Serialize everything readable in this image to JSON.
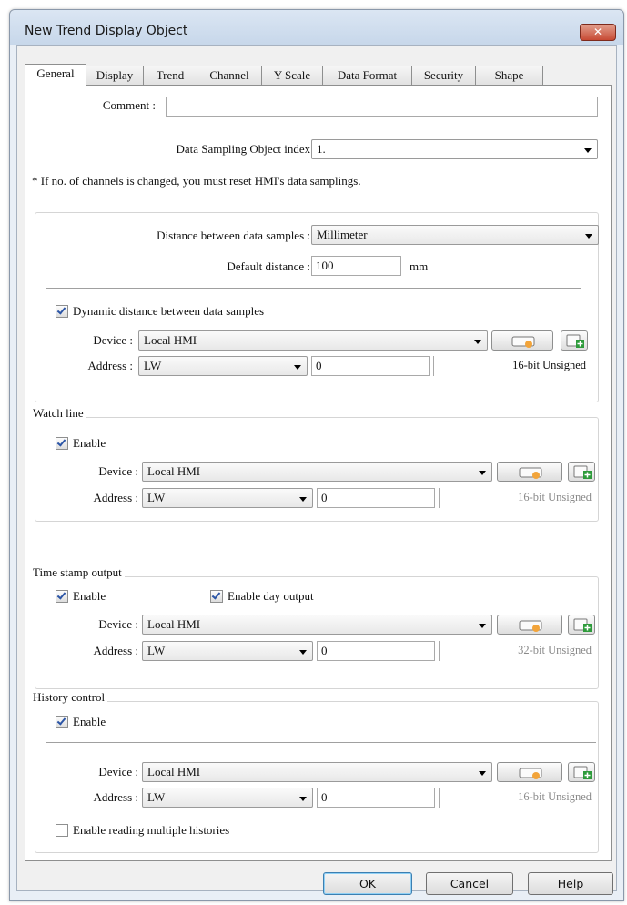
{
  "window": {
    "title": "New Trend Display Object",
    "close_glyph": "✕"
  },
  "tabs": [
    {
      "label": "General",
      "active": true
    },
    {
      "label": "Display"
    },
    {
      "label": "Trend"
    },
    {
      "label": "Channel"
    },
    {
      "label": "Y Scale"
    },
    {
      "label": "Data Format"
    },
    {
      "label": "Security"
    },
    {
      "label": "Shape"
    }
  ],
  "general": {
    "comment": {
      "label": "Comment :",
      "value": ""
    },
    "sampling": {
      "label": "Data Sampling Object index :",
      "value": "1."
    },
    "note": "* If no. of channels is changed, you must reset HMI's data samplings."
  },
  "distance": {
    "label": "Distance between data samples :",
    "value": "Millimeter",
    "default_label": "Default distance :",
    "default_value": "100",
    "unit": "mm",
    "dynamic_label": "Dynamic distance between data samples",
    "dynamic_checked": true,
    "device_label": "Device :",
    "device": "Local HMI",
    "address_label": "Address :",
    "address_type": "LW",
    "address_value": "0",
    "data_type": "16-bit Unsigned"
  },
  "watch_line": {
    "title": "Watch line",
    "enable_label": "Enable",
    "enable_checked": true,
    "device_label": "Device :",
    "device": "Local HMI",
    "address_label": "Address :",
    "address_type": "LW",
    "address_value": "0",
    "data_type": "16-bit Unsigned"
  },
  "time_stamp": {
    "title": "Time stamp output",
    "enable_label": "Enable",
    "enable_checked": true,
    "day_label": "Enable day output",
    "day_checked": true,
    "device_label": "Device :",
    "device": "Local HMI",
    "address_label": "Address :",
    "address_type": "LW",
    "address_value": "0",
    "data_type": "32-bit Unsigned"
  },
  "history": {
    "title": "History control",
    "enable_label": "Enable",
    "enable_checked": true,
    "device_label": "Device :",
    "device": "Local HMI",
    "address_label": "Address :",
    "address_type": "LW",
    "address_value": "0",
    "data_type": "16-bit Unsigned",
    "multiple_label": "Enable reading multiple histories",
    "multiple_checked": false
  },
  "buttons": {
    "ok": "OK",
    "cancel": "Cancel",
    "help": "Help"
  },
  "icons": {
    "settings_button": "device-settings-icon",
    "add_button": "add-device-icon"
  },
  "colors": {
    "checkmark": "#2b55a6",
    "title_bar": "#c7d7ea",
    "close_button": "#c74a34"
  }
}
